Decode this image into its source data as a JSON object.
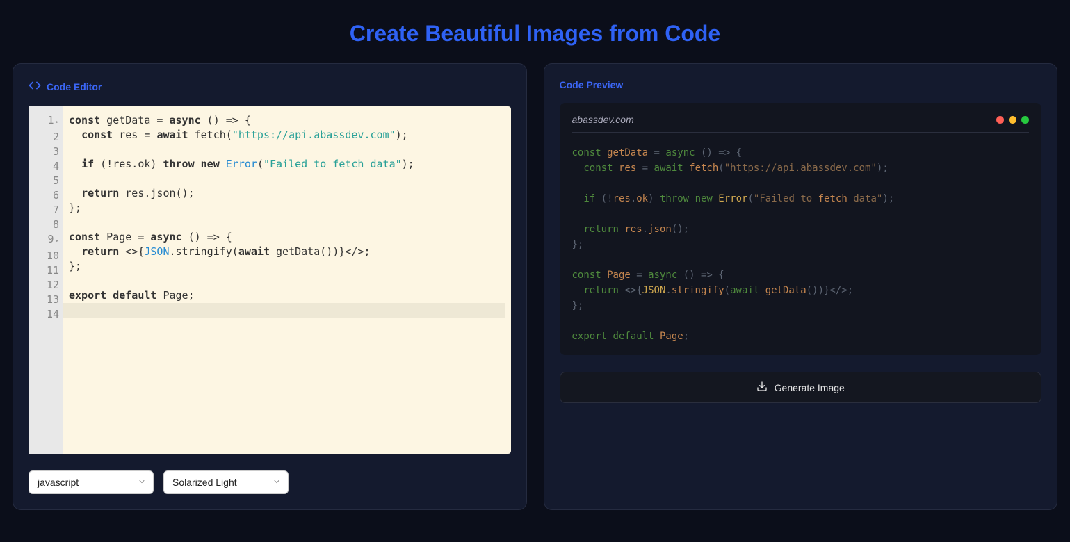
{
  "title": "Create Beautiful Images from Code",
  "editor": {
    "label": "Code Editor",
    "lineNumbers": [
      "1",
      "2",
      "3",
      "4",
      "5",
      "6",
      "7",
      "8",
      "9",
      "10",
      "11",
      "12",
      "13",
      "14"
    ],
    "foldLines": [
      0,
      8
    ],
    "code": "const getData = async () => {\n  const res = await fetch(\"https://api.abassdev.com\");\n\n  if (!res.ok) throw new Error(\"Failed to fetch data\");\n\n  return res.json();\n};\n\nconst Page = async () => {\n  return <>{JSON.stringify(await getData())}</>;\n};\n\nexport default Page;\n"
  },
  "controls": {
    "language": "javascript",
    "theme": "Solarized Light"
  },
  "preview": {
    "label": "Code Preview",
    "domain": "abassdev.com",
    "code": "const getData = async () => {\n  const res = await fetch(\"https://api.abassdev.com\");\n\n  if (!res.ok) throw new Error(\"Failed to fetch data\");\n\n  return res.json();\n};\n\nconst Page = async () => {\n  return <>{JSON.stringify(await getData())}</>;\n};\n\nexport default Page;"
  },
  "generateButton": "Generate Image"
}
